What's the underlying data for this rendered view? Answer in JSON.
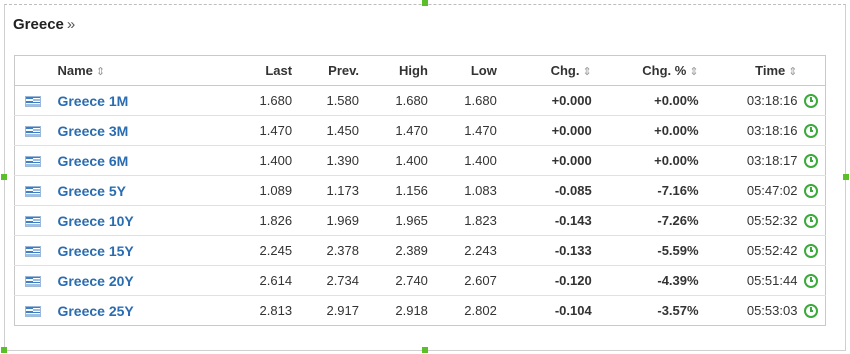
{
  "title": "Greece",
  "title_suffix": "»",
  "sort_glyph": "⇕",
  "columns": {
    "name": "Name",
    "last": "Last",
    "prev": "Prev.",
    "high": "High",
    "low": "Low",
    "chg": "Chg.",
    "chg_pct": "Chg. %",
    "time": "Time"
  },
  "colors": {
    "positive": "#2aa52a",
    "negative": "#e02020",
    "link": "#2a6cb0"
  },
  "rows": [
    {
      "name": "Greece 1M",
      "last": "1.680",
      "prev": "1.580",
      "high": "1.680",
      "low": "1.680",
      "chg": "+0.000",
      "chg_pct": "+0.00%",
      "time": "03:18:16",
      "dir": "pos"
    },
    {
      "name": "Greece 3M",
      "last": "1.470",
      "prev": "1.450",
      "high": "1.470",
      "low": "1.470",
      "chg": "+0.000",
      "chg_pct": "+0.00%",
      "time": "03:18:16",
      "dir": "pos"
    },
    {
      "name": "Greece 6M",
      "last": "1.400",
      "prev": "1.390",
      "high": "1.400",
      "low": "1.400",
      "chg": "+0.000",
      "chg_pct": "+0.00%",
      "time": "03:18:17",
      "dir": "pos"
    },
    {
      "name": "Greece 5Y",
      "last": "1.089",
      "prev": "1.173",
      "high": "1.156",
      "low": "1.083",
      "chg": "-0.085",
      "chg_pct": "-7.16%",
      "time": "05:47:02",
      "dir": "neg"
    },
    {
      "name": "Greece 10Y",
      "last": "1.826",
      "prev": "1.969",
      "high": "1.965",
      "low": "1.823",
      "chg": "-0.143",
      "chg_pct": "-7.26%",
      "time": "05:52:32",
      "dir": "neg"
    },
    {
      "name": "Greece 15Y",
      "last": "2.245",
      "prev": "2.378",
      "high": "2.389",
      "low": "2.243",
      "chg": "-0.133",
      "chg_pct": "-5.59%",
      "time": "05:52:42",
      "dir": "neg"
    },
    {
      "name": "Greece 20Y",
      "last": "2.614",
      "prev": "2.734",
      "high": "2.740",
      "low": "2.607",
      "chg": "-0.120",
      "chg_pct": "-4.39%",
      "time": "05:51:44",
      "dir": "neg"
    },
    {
      "name": "Greece 25Y",
      "last": "2.813",
      "prev": "2.917",
      "high": "2.918",
      "low": "2.802",
      "chg": "-0.104",
      "chg_pct": "-3.57%",
      "time": "05:53:03",
      "dir": "neg"
    }
  ]
}
